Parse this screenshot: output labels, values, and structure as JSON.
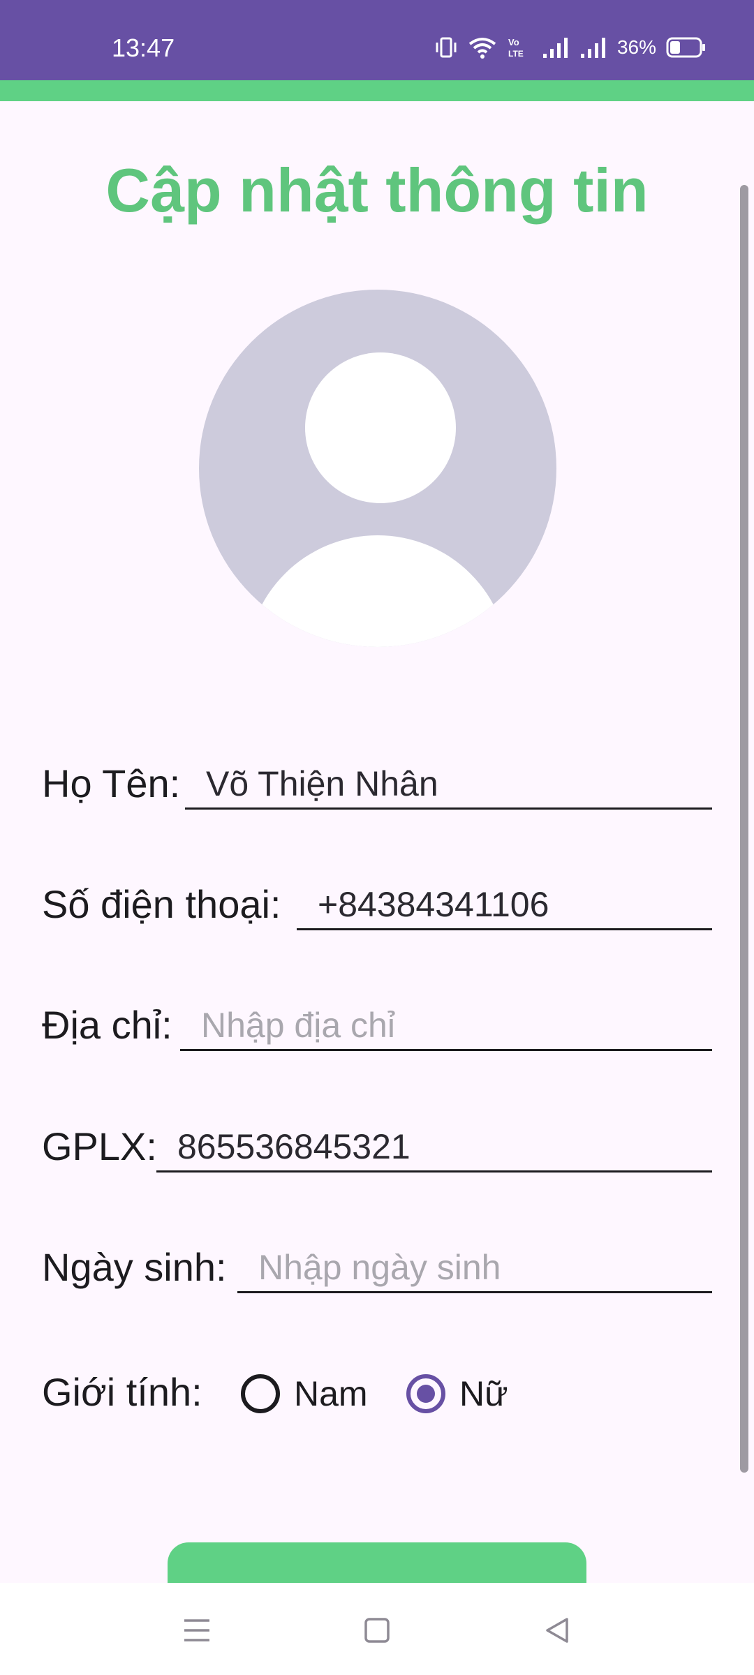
{
  "status_bar": {
    "time": "13:47",
    "battery_percent": "36%",
    "battery_level": 0.36,
    "icons": [
      "vibrate-icon",
      "wifi-icon",
      "volte-icon",
      "signal-icon",
      "signal-icon",
      "battery-icon"
    ]
  },
  "colors": {
    "status_bar": "#6750A4",
    "accent": "#5FD185",
    "title": "#5FC57D",
    "radio_selected": "#6750A4",
    "background": "#FEF7FF"
  },
  "page": {
    "title": "Cập nhật thông tin"
  },
  "avatar": {
    "icon": "default-avatar-icon"
  },
  "form": {
    "name": {
      "label": "Họ Tên:",
      "value": "Võ Thiện Nhân",
      "placeholder": ""
    },
    "phone": {
      "label": "Số điện thoại:",
      "value": "+84384341106",
      "placeholder": ""
    },
    "address": {
      "label": "Địa chỉ:",
      "value": "",
      "placeholder": "Nhập địa chỉ"
    },
    "license": {
      "label": "GPLX:",
      "value": "865536845321",
      "placeholder": ""
    },
    "birthdate": {
      "label": "Ngày sinh:",
      "value": "",
      "placeholder": "Nhập ngày sinh"
    },
    "gender": {
      "label": "Giới tính:",
      "options": [
        {
          "label": "Nam",
          "selected": false
        },
        {
          "label": "Nữ",
          "selected": true
        }
      ]
    }
  },
  "nav_bar": {
    "icons": [
      "menu-icon",
      "home-square-icon",
      "back-triangle-icon"
    ]
  }
}
